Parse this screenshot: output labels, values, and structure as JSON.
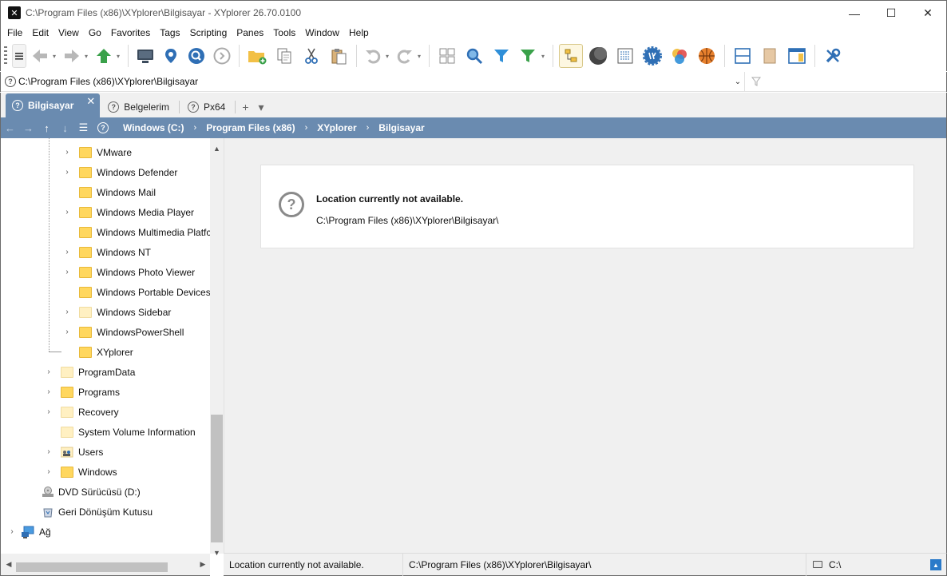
{
  "window": {
    "title": "C:\\Program Files (x86)\\XYplorer\\Bilgisayar - XYplorer 26.70.0100",
    "controls": {
      "minimize": "—",
      "maximize": "☐",
      "close": "✕"
    }
  },
  "menu": [
    "File",
    "Edit",
    "View",
    "Go",
    "Favorites",
    "Tags",
    "Scripting",
    "Panes",
    "Tools",
    "Window",
    "Help"
  ],
  "address": {
    "value": "C:\\Program Files (x86)\\XYplorer\\Bilgisayar",
    "filter_placeholder": ""
  },
  "tabs": [
    {
      "label": "Bilgisayar",
      "active": true
    },
    {
      "label": "Belgelerim",
      "active": false
    },
    {
      "label": "Px64",
      "active": false
    }
  ],
  "tab_controls": {
    "add": "+",
    "menu": "▾",
    "close": "✕"
  },
  "breadcrumb": [
    "Windows (C:)",
    "Program Files (x86)",
    "XYplorer",
    "Bilgisayar"
  ],
  "tree": [
    {
      "label": "VMware",
      "expandable": true,
      "type": "folder"
    },
    {
      "label": "Windows Defender",
      "expandable": true,
      "type": "folder"
    },
    {
      "label": "Windows Mail",
      "expandable": false,
      "type": "folder"
    },
    {
      "label": "Windows Media Player",
      "expandable": true,
      "type": "folder"
    },
    {
      "label": "Windows Multimedia Platfc",
      "expandable": false,
      "type": "folder"
    },
    {
      "label": "Windows NT",
      "expandable": true,
      "type": "folder"
    },
    {
      "label": "Windows Photo Viewer",
      "expandable": true,
      "type": "folder"
    },
    {
      "label": "Windows Portable Devices",
      "expandable": false,
      "type": "folder"
    },
    {
      "label": "Windows Sidebar",
      "expandable": true,
      "type": "folder-pale"
    },
    {
      "label": "WindowsPowerShell",
      "expandable": true,
      "type": "folder"
    },
    {
      "label": "XYplorer",
      "expandable": false,
      "type": "folder"
    },
    {
      "label": "ProgramData",
      "expandable": true,
      "type": "folder-pale"
    },
    {
      "label": "Programs",
      "expandable": true,
      "type": "folder"
    },
    {
      "label": "Recovery",
      "expandable": true,
      "type": "folder-pale"
    },
    {
      "label": "System Volume Information",
      "expandable": false,
      "type": "folder-pale"
    },
    {
      "label": "Users",
      "expandable": true,
      "type": "users-folder"
    },
    {
      "label": "Windows",
      "expandable": true,
      "type": "folder"
    },
    {
      "label": "DVD Sürücüsü (D:)",
      "expandable": false,
      "type": "dvd"
    },
    {
      "label": "Geri Dönüşüm Kutusu",
      "expandable": false,
      "type": "recycle"
    },
    {
      "label": "Ağ",
      "expandable": true,
      "type": "network"
    }
  ],
  "message": {
    "title": "Location currently not available.",
    "path": "C:\\Program Files (x86)\\XYplorer\\Bilgisayar\\"
  },
  "status": {
    "message": "Location currently not available.",
    "path": "C:\\Program Files (x86)\\XYplorer\\Bilgisayar\\",
    "drive": "C:\\"
  },
  "colors": {
    "accent": "#6a8bb0",
    "folder": "#ffd75e",
    "status_up": "#2a7ac9"
  }
}
